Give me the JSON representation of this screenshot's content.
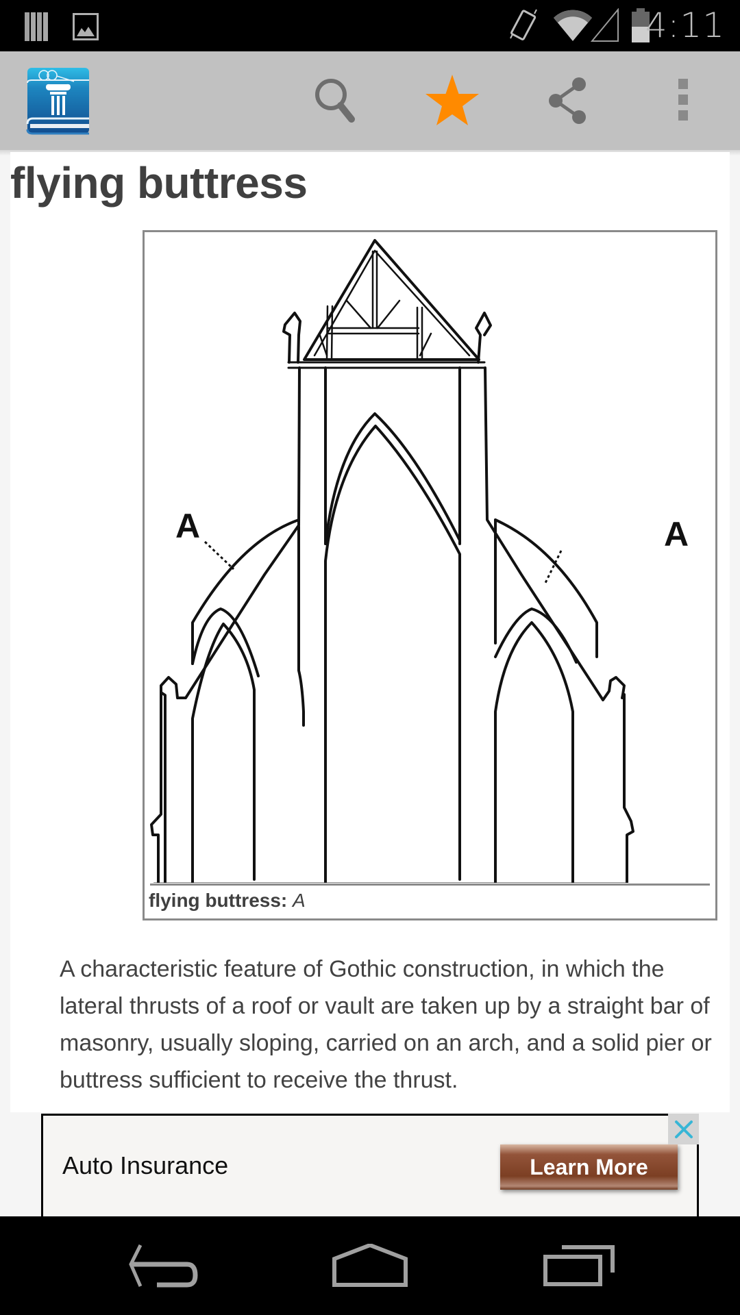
{
  "status_bar": {
    "time": "4:11",
    "left_icons": [
      "notification-stack-icon",
      "image-notification-icon"
    ],
    "right_icons": [
      "vibrate-icon",
      "wifi-icon",
      "cell-signal-icon",
      "battery-icon"
    ]
  },
  "action_bar": {
    "app_icon": "dictionary-book-icon",
    "actions": [
      {
        "name": "search",
        "icon": "search-icon"
      },
      {
        "name": "favorite",
        "icon": "star-icon",
        "active": true,
        "color": "#ff8a00"
      },
      {
        "name": "share",
        "icon": "share-icon"
      },
      {
        "name": "overflow",
        "icon": "more-vert-icon"
      }
    ]
  },
  "entry": {
    "headword": "flying buttress",
    "figure": {
      "labels": [
        "A",
        "A"
      ],
      "caption_term": "flying buttress:",
      "caption_label": "A"
    },
    "definition": "A characteristic feature of Gothic construction, in which the lateral thrusts of a roof or vault are taken up by a straight bar of masonry, usually sloping, carried on an arch, and a solid pier or buttress sufficient to receive the thrust."
  },
  "ad": {
    "text": "Auto Insurance",
    "button_label": "Learn More",
    "close_icon": "close-icon",
    "close_color": "#37b6d6",
    "button_color": "#7c3f23"
  },
  "nav_bar": {
    "buttons": [
      "back",
      "home",
      "recents"
    ]
  }
}
